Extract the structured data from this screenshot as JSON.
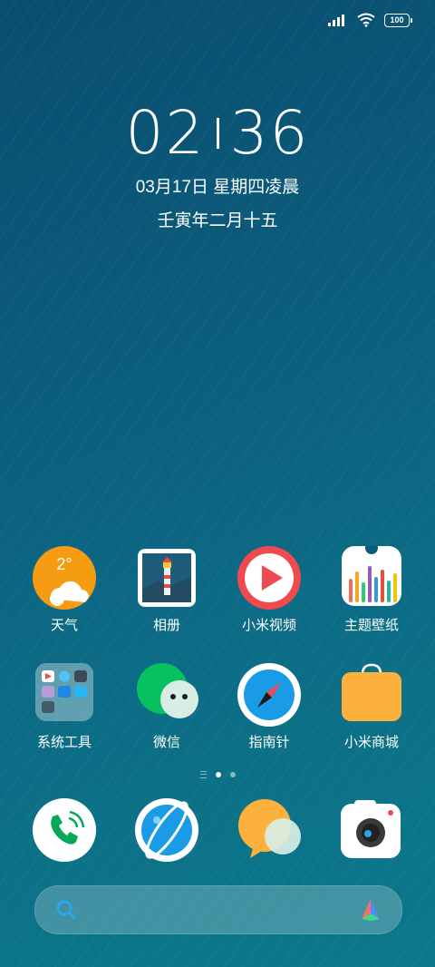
{
  "status_bar": {
    "battery": "100",
    "icons": [
      "signal-icon",
      "wifi-icon",
      "battery-icon"
    ]
  },
  "clock": {
    "hours": "02",
    "minutes": "36",
    "date": "03月17日 星期四凌晨",
    "lunar": "壬寅年二月十五"
  },
  "apps": {
    "weather": {
      "label": "天气",
      "temp": "2°"
    },
    "gallery": {
      "label": "相册"
    },
    "mi_video": {
      "label": "小米视频"
    },
    "themes": {
      "label": "主题壁纸"
    },
    "tools": {
      "label": "系统工具"
    },
    "wechat": {
      "label": "微信"
    },
    "compass": {
      "label": "指南针"
    },
    "mi_store": {
      "label": "小米商城"
    }
  },
  "page_indicator": {
    "pages": 2,
    "active": 0
  },
  "dock": [
    "phone",
    "browser",
    "messages",
    "camera"
  ],
  "colors": {
    "accent_orange": "#f59c12",
    "accent_red": "#ef4a4f",
    "accent_blue": "#1a9be6"
  }
}
